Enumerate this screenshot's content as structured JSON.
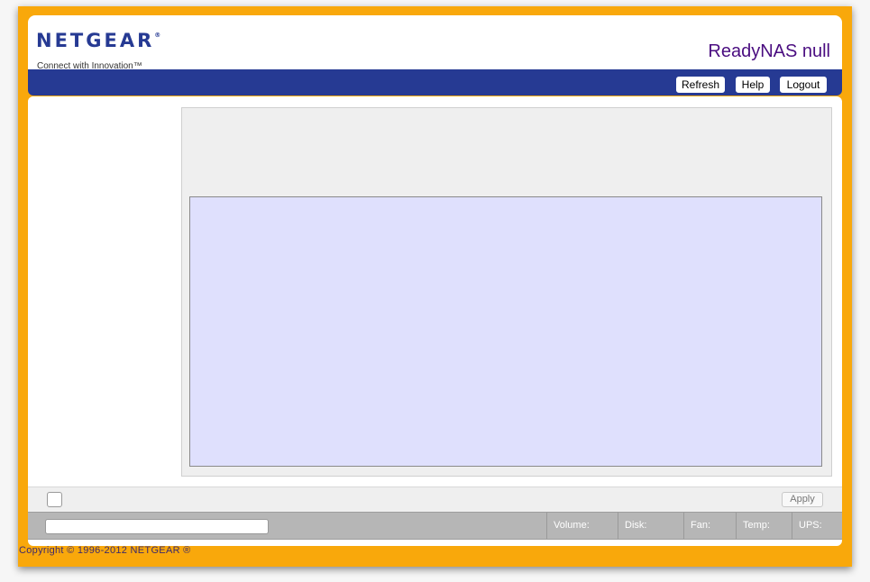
{
  "header": {
    "logo_text": "NETGEAR",
    "logo_registered": "®",
    "logo_tagline": "Connect with Innovation™",
    "product_title": "ReadyNAS null"
  },
  "toolbar": {
    "refresh_label": "Refresh",
    "help_label": "Help",
    "logout_label": "Logout"
  },
  "action_bar": {
    "apply_label": "Apply"
  },
  "status_bar": {
    "volume_label": "Volume:",
    "disk_label": "Disk:",
    "fan_label": "Fan:",
    "temp_label": "Temp:",
    "ups_label": "UPS:"
  },
  "footer": {
    "copyright": "Copyright © 1996-2012 NETGEAR ®"
  },
  "colors": {
    "frame_orange": "#f9a80b",
    "nav_blue": "#263a93",
    "title_purple": "#4a0d80",
    "panel_lavender": "#dfe0fd"
  }
}
